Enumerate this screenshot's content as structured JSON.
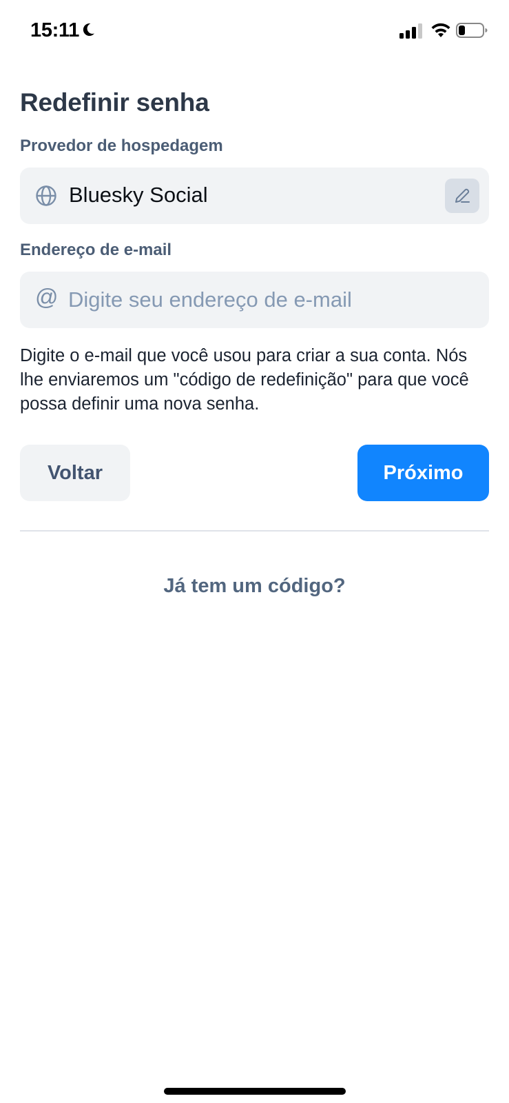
{
  "status_bar": {
    "time": "15:11",
    "icons": [
      "moon-icon",
      "signal-icon",
      "wifi-icon",
      "battery-icon"
    ]
  },
  "page": {
    "title": "Redefinir senha"
  },
  "provider": {
    "label": "Provedor de hospedagem",
    "value": "Bluesky Social",
    "icon": "globe-icon",
    "edit_icon": "pencil-icon"
  },
  "email": {
    "label": "Endereço de e-mail",
    "value": "",
    "placeholder": "Digite seu endereço de e-mail",
    "icon_glyph": "@"
  },
  "help_text": "Digite o e-mail que você usou para criar a sua conta. Nós lhe enviaremos um \"código de redefinição\" para que você possa definir uma nova senha.",
  "actions": {
    "back_label": "Voltar",
    "next_label": "Próximo"
  },
  "have_code_label": "Já tem um código?",
  "colors": {
    "primary": "#1185fe",
    "field_bg": "#f1f3f5",
    "label": "#4b5d75",
    "title": "#2d3848"
  }
}
